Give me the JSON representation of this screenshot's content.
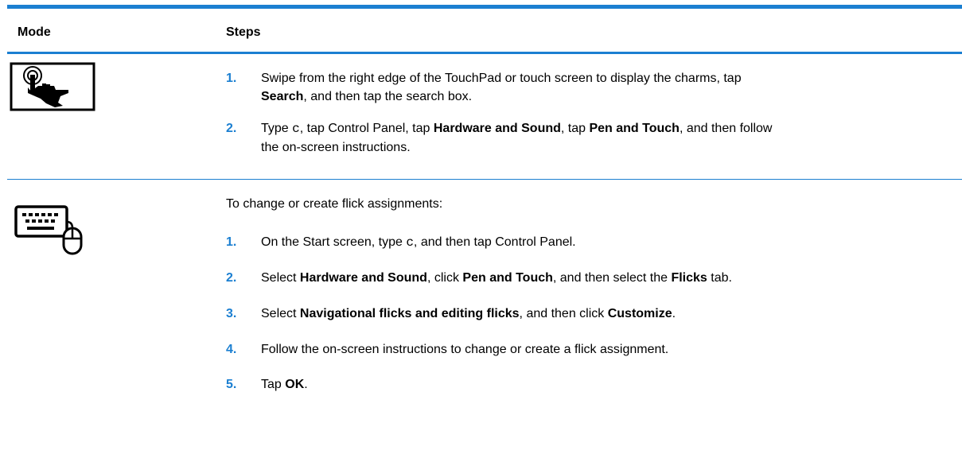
{
  "header": {
    "mode": "Mode",
    "steps": "Steps"
  },
  "rows": [
    {
      "icon": "touch-gesture-icon",
      "steps": [
        {
          "num": "1.",
          "line1": "Swipe from the right edge of the TouchPad or touch screen to display the charms, tap",
          "search": "Search",
          "rest": ", and then tap the search box."
        },
        {
          "num": "2.",
          "t1": "Type ",
          "code": "c",
          "t2": ", tap Control Panel, tap ",
          "b1": "Hardware and Sound",
          "t3": ", tap ",
          "b2": "Pen and Touch",
          "t4": ", and then follow",
          "line2": "the on-screen instructions."
        }
      ]
    },
    {
      "icon": "keyboard-mouse-icon",
      "intro": "To change or create flick assignments:",
      "steps": [
        {
          "num": "1.",
          "t1": "On the Start screen, type ",
          "code": "c",
          "t2": ", and then tap Control Panel."
        },
        {
          "num": "2.",
          "t1": "Select ",
          "b1": "Hardware and Sound",
          "t2": ", click ",
          "b2": "Pen and Touch",
          "t3": ", and then select the ",
          "b3": "Flicks",
          "t4": " tab."
        },
        {
          "num": "3.",
          "t1": "Select ",
          "b1": "Navigational flicks and editing flicks",
          "t2": ", and then click ",
          "b2": "Customize",
          "t3": "."
        },
        {
          "num": "4.",
          "t1": "Follow the on-screen instructions to change or create a flick assignment."
        },
        {
          "num": "5.",
          "t1": "Tap ",
          "b1": "OK",
          "t2": "."
        }
      ]
    }
  ],
  "colors": {
    "accent": "#1b7fd1"
  }
}
